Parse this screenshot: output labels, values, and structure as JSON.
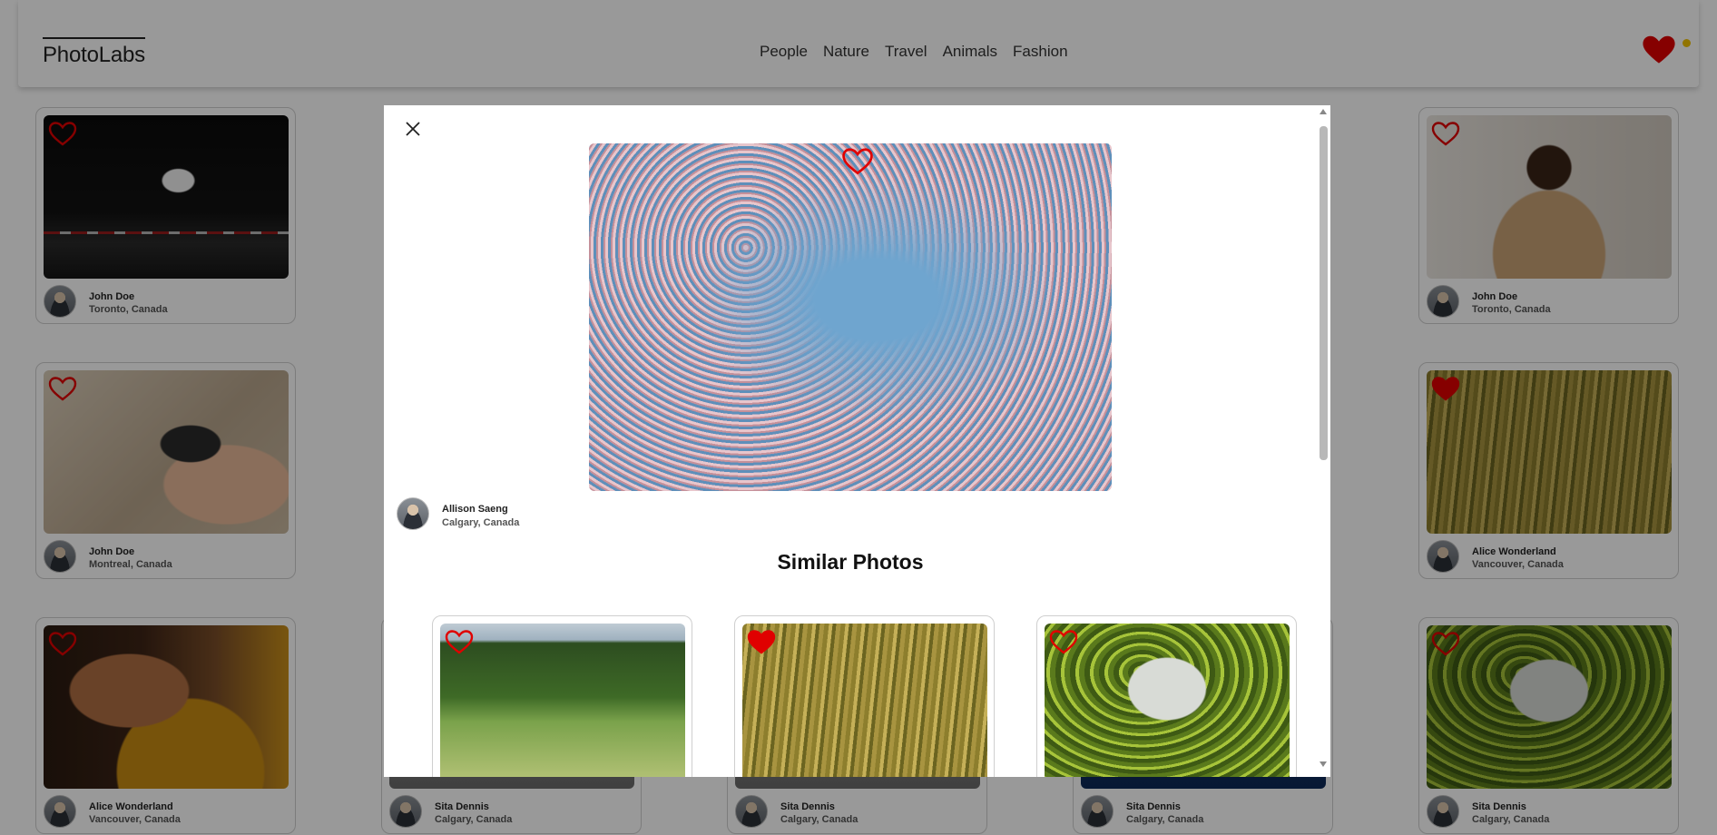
{
  "app": {
    "logo": "PhotoLabs",
    "topics": [
      "People",
      "Nature",
      "Travel",
      "Animals",
      "Fashion"
    ]
  },
  "grid": {
    "cards": [
      {
        "user": "John Doe",
        "location": "Toronto, Canada",
        "favorited": false,
        "photo": "man walking at night"
      },
      {
        "user": "John Doe",
        "location": "Toronto, Canada",
        "favorited": false,
        "photo": "smiling man with mug"
      },
      {
        "user": "John Doe",
        "location": "Montreal, Canada",
        "favorited": false,
        "photo": "hand holding phone"
      },
      {
        "user": "Alice Wonderland",
        "location": "Vancouver, Canada",
        "favorited": true,
        "photo": "bird in tall grass"
      },
      {
        "user": "Alice Wonderland",
        "location": "Vancouver, Canada",
        "favorited": false,
        "photo": "woman with curly hair"
      },
      {
        "user": "Sita Dennis",
        "location": "Calgary, Canada",
        "favorited": false,
        "photo": ""
      },
      {
        "user": "Sita Dennis",
        "location": "Calgary, Canada",
        "favorited": false,
        "photo": ""
      },
      {
        "user": "Sita Dennis",
        "location": "Calgary, Canada",
        "favorited": false,
        "photo": ""
      },
      {
        "user": "Sita Dennis",
        "location": "Calgary, Canada",
        "favorited": false,
        "photo": "rice terraces"
      }
    ]
  },
  "modal": {
    "photo": {
      "user": "Allison Saeng",
      "location": "Calgary, Canada",
      "favorited": false,
      "description": "cherry blossoms against blue sky"
    },
    "similar_title": "Similar Photos",
    "similar": [
      {
        "photo": "horses grazing on hillside",
        "favorited": false
      },
      {
        "photo": "bird in tall grass",
        "favorited": true
      },
      {
        "photo": "rice terraces",
        "favorited": false
      }
    ]
  },
  "colors": {
    "heart": "#e00000",
    "notification": "#f2c200",
    "overlay": "rgba(0,0,0,0.4)"
  }
}
